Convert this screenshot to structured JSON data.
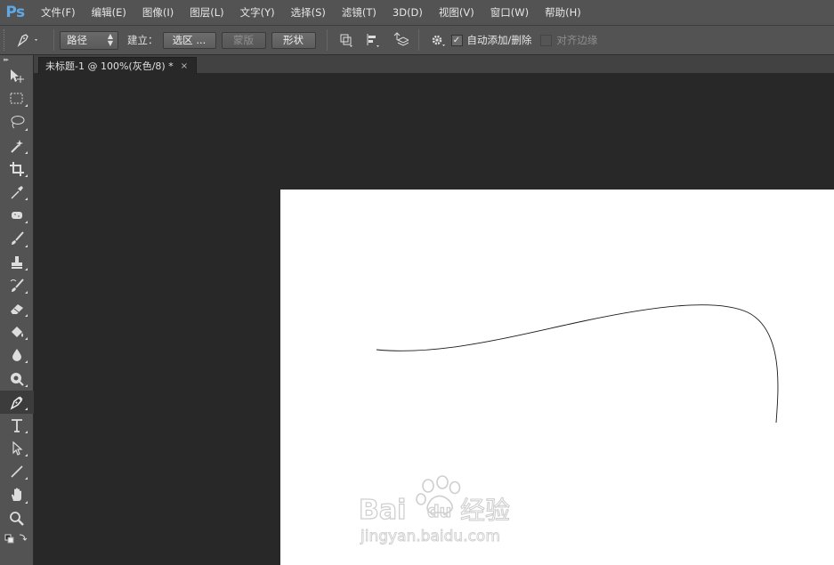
{
  "app": {
    "logo": "Ps"
  },
  "menu": [
    "文件(F)",
    "编辑(E)",
    "图像(I)",
    "图层(L)",
    "文字(Y)",
    "选择(S)",
    "滤镜(T)",
    "3D(D)",
    "视图(V)",
    "窗口(W)",
    "帮助(H)"
  ],
  "options": {
    "tool_icon": "pen-icon",
    "mode_value": "路径",
    "make_label": "建立：",
    "selection_btn": "选区 ...",
    "mask_btn": "蒙版",
    "shape_btn": "形状",
    "auto_add_delete_label": "自动添加/删除",
    "auto_add_delete_checked": true,
    "align_edges_label": "对齐边缘",
    "align_edges_checked": false
  },
  "document": {
    "tab_title": "未标题-1 @ 100%(灰色/8) *",
    "close_glyph": "×"
  },
  "toolbox": {
    "active_tool": "pen-tool",
    "tools": [
      "move-tool",
      "marquee-tool",
      "lasso-tool",
      "magic-wand-tool",
      "crop-tool",
      "eyedropper-tool",
      "spot-healing-tool",
      "brush-tool",
      "clone-stamp-tool",
      "history-brush-tool",
      "eraser-tool",
      "paint-bucket-tool",
      "blur-tool",
      "dodge-tool",
      "pen-tool",
      "type-tool",
      "path-selection-tool",
      "line-tool",
      "hand-tool",
      "zoom-tool"
    ]
  },
  "watermark": {
    "brand": "Bai",
    "brand_tail": "du",
    "jingyan": "经验",
    "url": "jingyan.baidu.com"
  },
  "colors": {
    "chrome": "#535353",
    "workspace": "#282828",
    "canvas": "#ffffff",
    "path_stroke": "#1a1a1a",
    "logo": "#5fa8e6"
  }
}
